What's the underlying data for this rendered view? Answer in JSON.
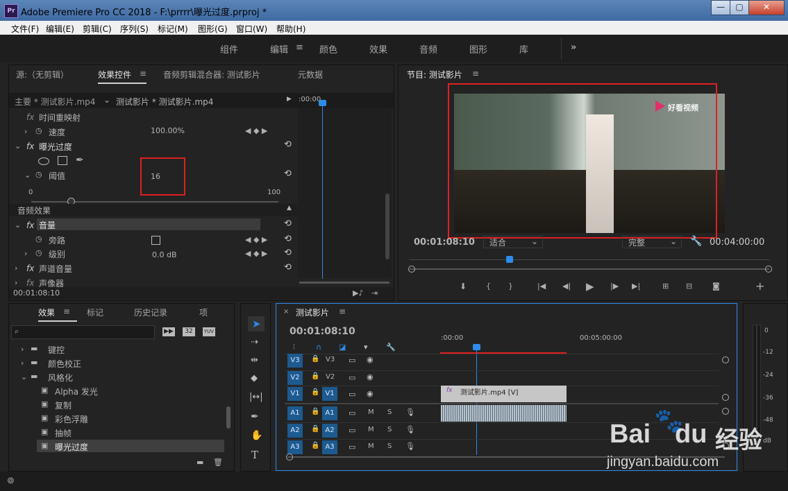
{
  "window": {
    "logo": "Pr",
    "title": "Adobe Premiere Pro CC 2018 - F:\\prrrr\\曝光过度.prproj *",
    "min": "—",
    "max": "▢",
    "close": "✕"
  },
  "menu": [
    "文件(F)",
    "编辑(E)",
    "剪辑(C)",
    "序列(S)",
    "标记(M)",
    "图形(G)",
    "窗口(W)",
    "帮助(H)"
  ],
  "workspaces": [
    "组件",
    "编辑",
    "颜色",
    "效果",
    "音频",
    "图形",
    "库"
  ],
  "workspace_more": "»",
  "source_panel": {
    "tabs": [
      "源:（无剪辑）",
      "效果控件",
      "音频剪辑混合器: 测试影片",
      "元数据"
    ],
    "clip_master": "主要 * 测试影片.mp4",
    "clip_seq": "测试影片 * 测试影片.mp4",
    "timecode_start": ":00:00",
    "time_remap": "时间重映射",
    "speed_label": "速度",
    "speed_value": "100.00%",
    "effect_name": "曝光过度",
    "threshold_label": "阈值",
    "threshold_value": "16",
    "slider_min": "0",
    "slider_max": "100",
    "audio_effects": "音频效果",
    "volume": "音量",
    "bypass": "旁路",
    "level": "级别",
    "level_value": "0.0 dB",
    "channel_volume": "声道音量",
    "panner": "声像器",
    "timecode": "00:01:08:10"
  },
  "program_monitor": {
    "title": "节目: 测试影片",
    "timecode": "00:01:08:10",
    "fit": "适合",
    "quality": "完整",
    "duration": "00:04:00:00",
    "watermark": "好看视频"
  },
  "effects_panel": {
    "tabs": [
      "效果",
      "标记",
      "历史记录",
      "项"
    ],
    "badges": [
      "32",
      "YUV"
    ],
    "folders": [
      "键控",
      "颜色校正",
      "风格化"
    ],
    "items": [
      "Alpha 发光",
      "复制",
      "彩色浮雕",
      "抽帧",
      "曝光过度"
    ]
  },
  "timeline": {
    "title": "测试影片",
    "timecode": "00:01:08:10",
    "ruler": [
      ":00:00",
      "00:05:00:00"
    ],
    "video_tracks": [
      "V3",
      "V2",
      "V1"
    ],
    "audio_tracks": [
      "A1",
      "A2",
      "A3"
    ],
    "clip_label": "测试影片.mp4 [V]",
    "m": "M",
    "s": "S"
  },
  "audio_meter": {
    "labels": [
      "0",
      "-12",
      "-24",
      "-36",
      "-48",
      "dB"
    ]
  },
  "watermark": {
    "brand": "Bai",
    "brand2": "du",
    "brand3": "经验",
    "url": "jingyan.baidu.com"
  },
  "colors": {
    "accent": "#2d8ceb",
    "highlight": "#e02020"
  }
}
